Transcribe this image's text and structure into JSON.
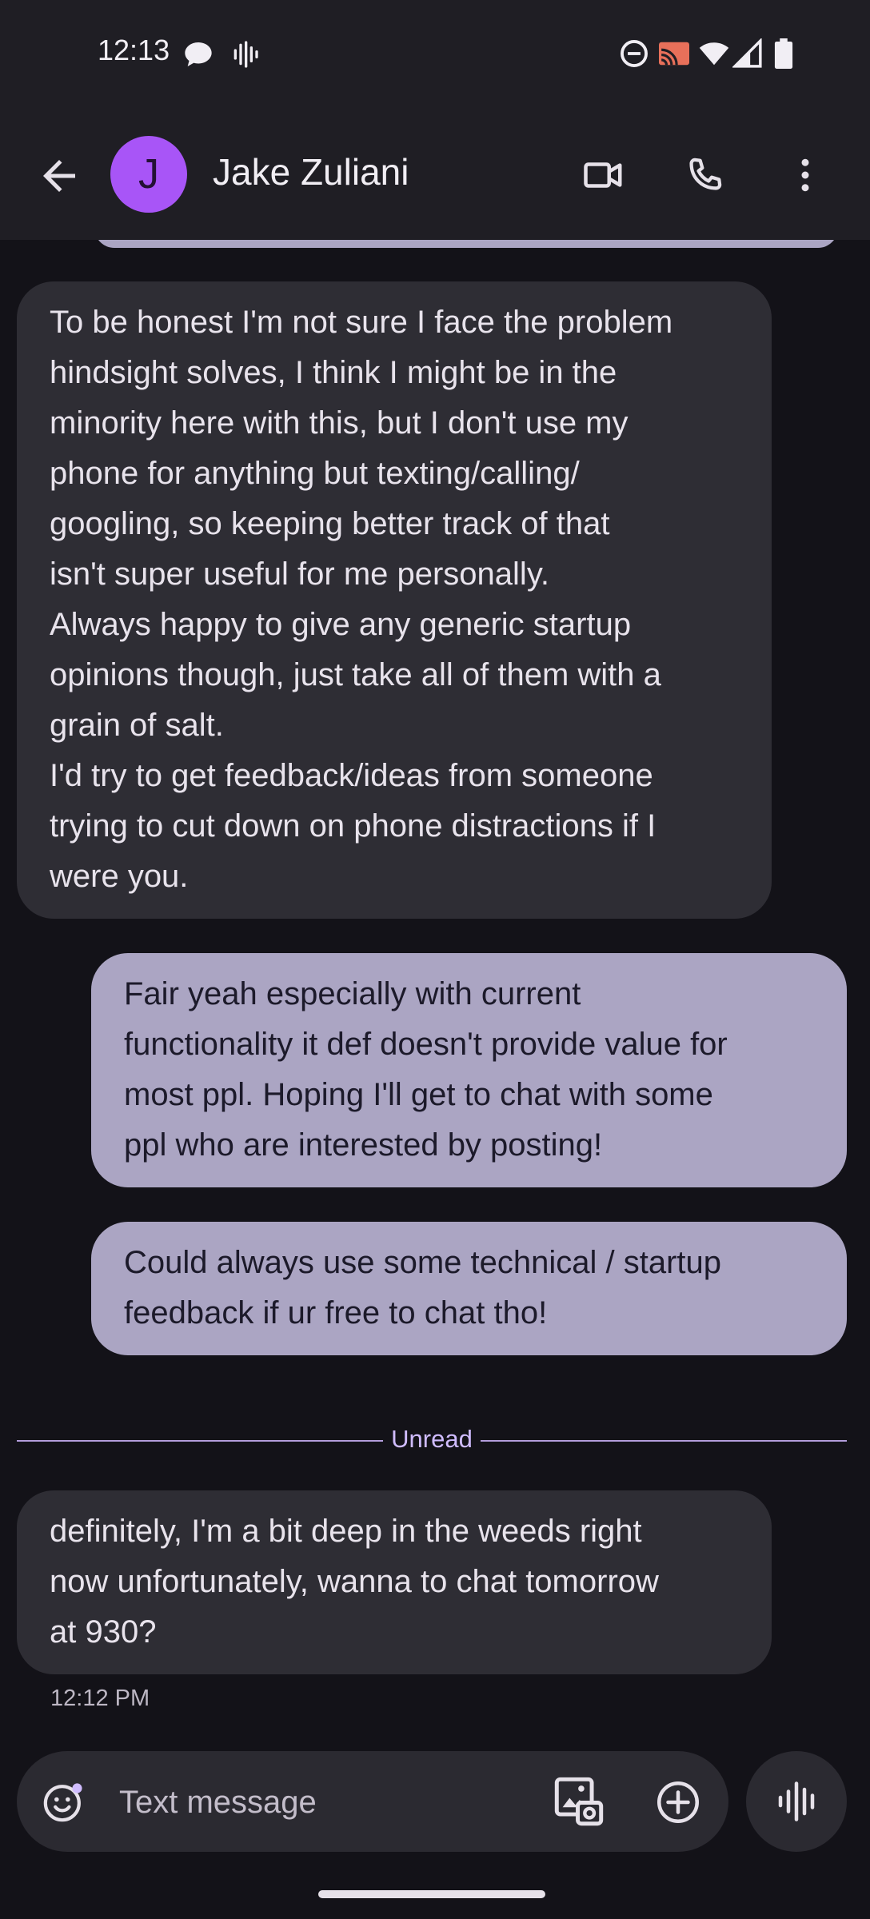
{
  "status_bar": {
    "time": "12:13",
    "left_icons": [
      "chat-bubble-icon",
      "voice-wave-icon"
    ],
    "right_icons": [
      "do-not-disturb-icon",
      "cast-icon",
      "wifi-icon",
      "signal-icon",
      "battery-icon"
    ]
  },
  "header": {
    "avatar_initial": "J",
    "avatar_color": "#a855f7",
    "contact_name": "Jake Zuliani",
    "actions": [
      "video-call-icon",
      "phone-icon",
      "more-vert-icon"
    ]
  },
  "messages": [
    {
      "direction": "incoming",
      "text": "To be honest I'm not sure I face the problem\nhindsight solves, I think I might be in the\nminority here with this, but I don't use my\nphone for anything but texting/calling/\ngoogling, so keeping better track of that\nisn't super useful for me personally.\nAlways happy to give any generic startup\nopinions though, just take all of them with a\ngrain of salt.\nI'd try to get feedback/ideas from someone\ntrying to cut down on phone distractions if I\nwere you."
    },
    {
      "direction": "outgoing",
      "text": "Fair yeah especially with current\nfunctionality it def doesn't provide value for\nmost ppl. Hoping I'll get to chat with some\nppl who are interested by posting!"
    },
    {
      "direction": "outgoing",
      "text": "Could always use some technical / startup\nfeedback if ur free to chat tho!"
    },
    {
      "direction": "incoming",
      "text": "definitely, I'm a bit deep in the weeds right\nnow unfortunately, wanna to chat tomorrow\nat 930?"
    }
  ],
  "unread_label": "Unread",
  "last_timestamp": "12:12 PM",
  "composer": {
    "placeholder": "Text message",
    "icons": [
      "emoji-icon",
      "gallery-icon",
      "add-circle-icon",
      "voice-message-icon"
    ]
  },
  "colors": {
    "background": "#131218",
    "incoming_bubble": "#2e2d34",
    "outgoing_bubble": "#aba5c3",
    "accent": "#d0bcff"
  }
}
